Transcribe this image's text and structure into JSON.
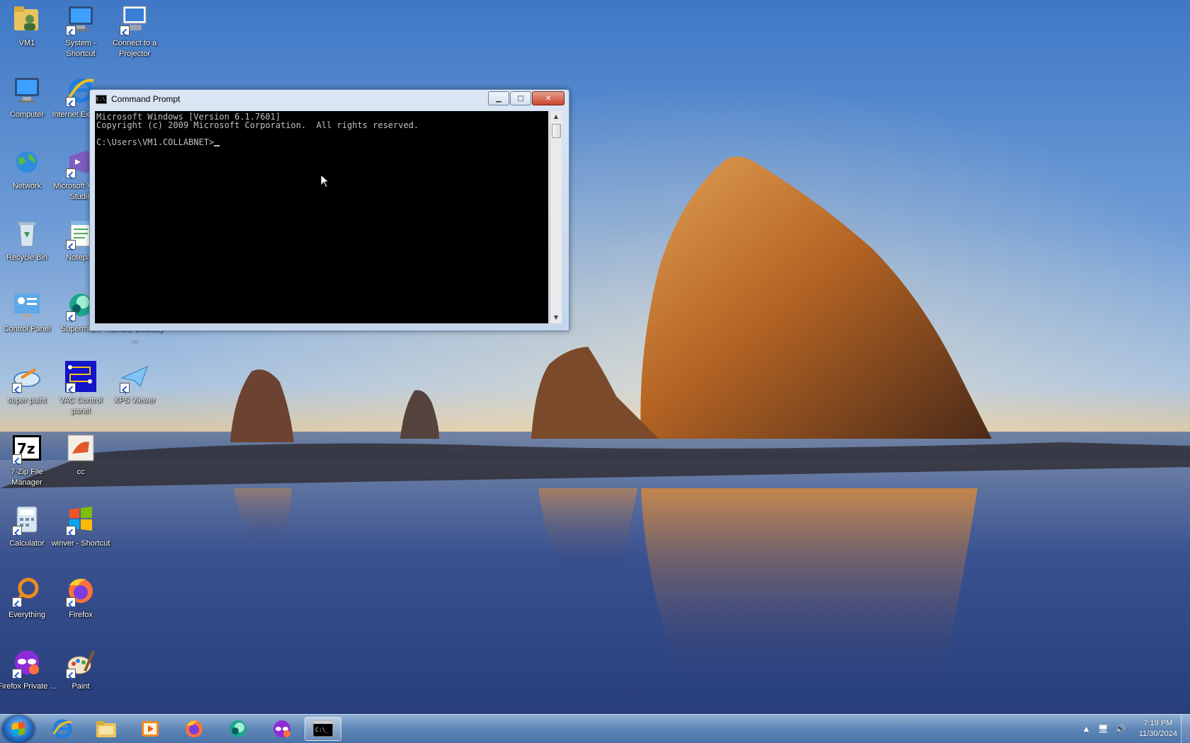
{
  "desktop": {
    "icons": [
      {
        "label": "VM1",
        "kind": "user-folder"
      },
      {
        "label": "System - Shortcut",
        "kind": "system"
      },
      {
        "label": "Connect to a Projector",
        "kind": "projector"
      },
      {
        "label": "Computer",
        "kind": "computer"
      },
      {
        "label": "Internet Explorer",
        "kind": "ie"
      },
      {
        "label": "Network",
        "kind": "network"
      },
      {
        "label": "Microsoft Visual Studio",
        "kind": "vs"
      },
      {
        "label": "Recycle Bin",
        "kind": "recycle"
      },
      {
        "label": "Notepad",
        "kind": "notepad"
      },
      {
        "label": "Control Panel",
        "kind": "control-panel"
      },
      {
        "label": "Supermium",
        "kind": "supermium"
      },
      {
        "label": "Remote Desktop ...",
        "kind": "remote"
      },
      {
        "label": "super paint",
        "kind": "superpaint"
      },
      {
        "label": "VAC Control panel",
        "kind": "vac"
      },
      {
        "label": "XPS Viewer",
        "kind": "xps"
      },
      {
        "label": "7-Zip File Manager",
        "kind": "7zip"
      },
      {
        "label": "cc",
        "kind": "cc"
      },
      {
        "label": "Calculator",
        "kind": "calculator"
      },
      {
        "label": "winver - Shortcut",
        "kind": "winver"
      },
      {
        "label": "Everything",
        "kind": "everything"
      },
      {
        "label": "Firefox",
        "kind": "firefox"
      },
      {
        "label": "Firefox Private ...",
        "kind": "firefox-private"
      },
      {
        "label": "Paint",
        "kind": "paint"
      }
    ]
  },
  "cmd_window": {
    "title": "Command Prompt",
    "lines": [
      "Microsoft Windows [Version 6.1.7601]",
      "Copyright (c) 2009 Microsoft Corporation.  All rights reserved.",
      "",
      "C:\\Users\\VM1.COLLABNET>"
    ]
  },
  "taskbar": {
    "items": [
      "internet-explorer",
      "file-explorer",
      "media-player",
      "firefox",
      "supermium",
      "firefox-private",
      "command-prompt"
    ],
    "active": "command-prompt",
    "clock_time": "7:19 PM",
    "clock_date": "11/30/2024"
  }
}
